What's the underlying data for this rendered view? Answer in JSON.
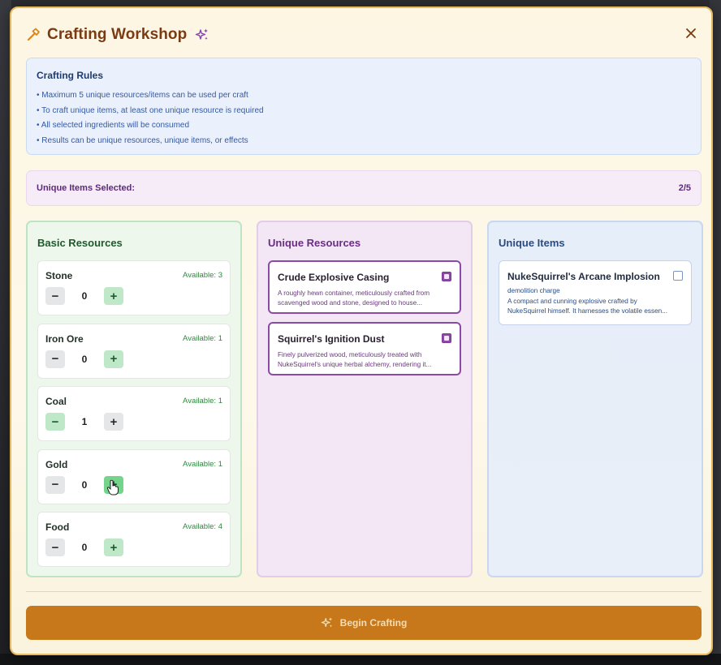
{
  "modal": {
    "title": "Crafting Workshop",
    "close_icon": "close-icon",
    "title_icon": "hammer-icon",
    "title_suffix_icon": "sparkles-icon"
  },
  "rules": {
    "title": "Crafting Rules",
    "items": [
      "• Maximum 5 unique resources/items can be used per craft",
      "• To craft unique items, at least one unique resource is required",
      "• All selected ingredients will be consumed",
      "• Results can be unique resources, unique items, or effects"
    ]
  },
  "selection": {
    "label": "Unique Items Selected:",
    "count": "2/5"
  },
  "basic_resources": {
    "title": "Basic Resources",
    "items": [
      {
        "name": "Stone",
        "available": "Available: 3",
        "value": "0",
        "minus": "−",
        "plus": "+"
      },
      {
        "name": "Iron Ore",
        "available": "Available: 1",
        "value": "0",
        "minus": "−",
        "plus": "+"
      },
      {
        "name": "Coal",
        "available": "Available: 1",
        "value": "1",
        "minus": "−",
        "plus": "+"
      },
      {
        "name": "Gold",
        "available": "Available: 1",
        "value": "0",
        "minus": "−",
        "plus": "+"
      },
      {
        "name": "Food",
        "available": "Available: 4",
        "value": "0",
        "minus": "−",
        "plus": "+"
      }
    ]
  },
  "unique_resources": {
    "title": "Unique Resources",
    "items": [
      {
        "name": "Crude Explosive Casing",
        "desc_line1": "A roughly hewn container, meticulously crafted from",
        "desc_line2": "scavenged wood and stone, designed to house...",
        "checked": true
      },
      {
        "name": "Squirrel's Ignition Dust",
        "desc_line1": "Finely pulverized wood, meticulously treated with",
        "desc_line2": "NukeSquirrel's unique herbal alchemy, rendering it...",
        "checked": true
      }
    ]
  },
  "unique_items": {
    "title": "Unique Items",
    "items": [
      {
        "name": "NukeSquirrel's Arcane Implosion",
        "subtitle": "demolition charge",
        "desc_line1": "A compact and cunning explosive crafted by",
        "desc_line2": "NukeSquirrel himself. It harnesses the volatile essen...",
        "checked": false
      }
    ]
  },
  "footer": {
    "button_label": "Begin Crafting",
    "button_icon": "sparkles-icon"
  },
  "colors": {
    "accent": "#c6781a",
    "title": "#7a3b12",
    "basic_green": "#2d8a3e",
    "unique_purple": "#8b4aa8",
    "items_blue": "#2a4c82"
  }
}
